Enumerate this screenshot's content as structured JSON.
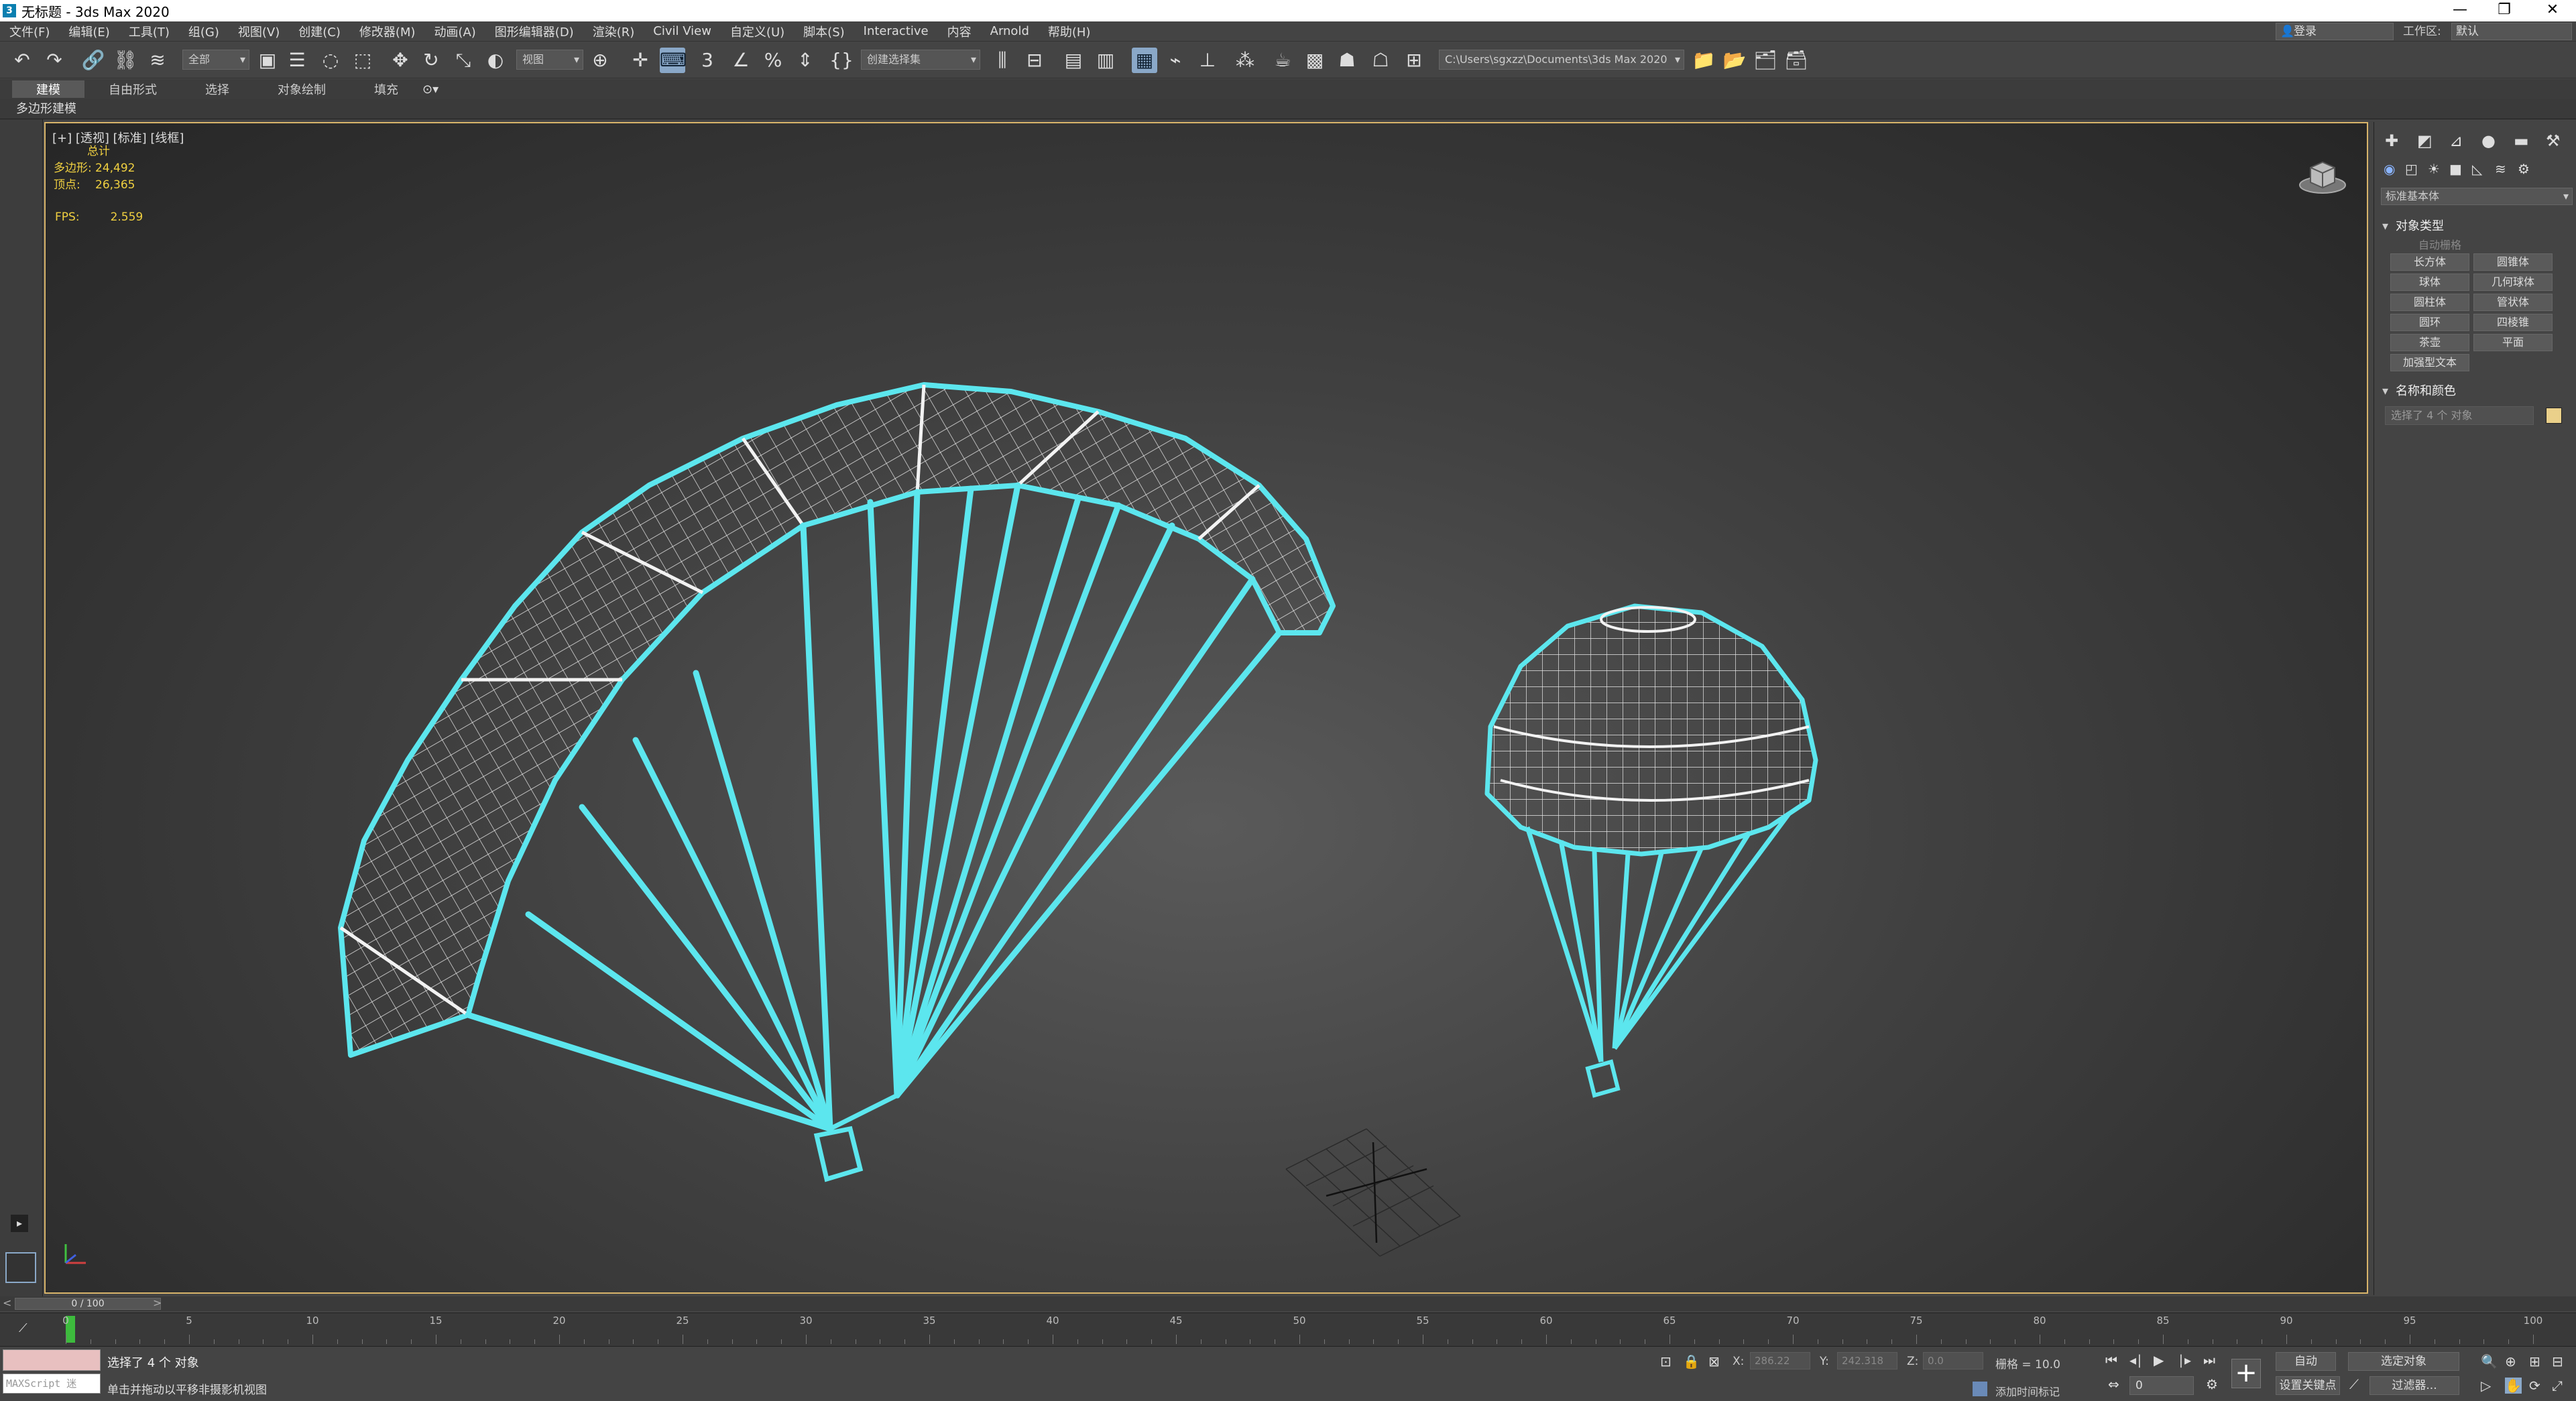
{
  "window": {
    "title": "无标题 - 3ds Max 2020",
    "app_icon": "3",
    "min": "—",
    "max": "❐",
    "close": "✕"
  },
  "menu": {
    "items": [
      "文件(F)",
      "编辑(E)",
      "工具(T)",
      "组(G)",
      "视图(V)",
      "创建(C)",
      "修改器(M)",
      "动画(A)",
      "图形编辑器(D)",
      "渲染(R)",
      "Civil View",
      "自定义(U)",
      "脚本(S)",
      "Interactive",
      "内容",
      "Arnold",
      "帮助(H)"
    ]
  },
  "account": {
    "login": "登录",
    "workspace_label": "工作区:",
    "workspace_value": "默认"
  },
  "toolbar": {
    "selection_filter": "全部",
    "ref_coord": "视图",
    "named_selection": "创建选择集",
    "project_path": "C:\\Users\\sgxzz\\Documents\\3ds Max 2020"
  },
  "ribbon": {
    "tabs": [
      "建模",
      "自由形式",
      "选择",
      "对象绘制",
      "填充"
    ],
    "active_tab": "建模",
    "sub_label": "多边形建模"
  },
  "viewport": {
    "label": "[+] [透视] [标准] [线框]",
    "stats_header": "总计",
    "poly_label": "多边形:",
    "poly_value": "24,492",
    "vert_label": "顶点:",
    "vert_value": "26,365",
    "fps_label": "FPS:",
    "fps_value": "2.559"
  },
  "command_panel": {
    "category_dropdown": "标准基本体",
    "rollout_object_type": "对象类型",
    "autogrid": "自动栅格",
    "buttons": [
      "长方体",
      "圆锥体",
      "球体",
      "几何球体",
      "圆柱体",
      "管状体",
      "圆环",
      "四棱锥",
      "茶壶",
      "平面",
      "加强型文本"
    ],
    "rollout_name_color": "名称和颜色",
    "name_field": "选择了 4 个 对象",
    "color": "#ead08a"
  },
  "timeline": {
    "slider": "0 / 100",
    "ticks": [
      "0",
      "5",
      "10",
      "15",
      "20",
      "25",
      "30",
      "35",
      "40",
      "45",
      "50",
      "55",
      "60",
      "65",
      "70",
      "75",
      "80",
      "85",
      "90",
      "95",
      "100"
    ]
  },
  "status": {
    "maxscript": "MAXScript 迷",
    "selected": "选择了 4 个 对象",
    "hint": "单击并拖动以平移非摄影机视图",
    "x_label": "X:",
    "x_value": "286.22",
    "y_label": "Y:",
    "y_value": "242.318",
    "z_label": "Z:",
    "z_value": "0.0",
    "grid": "栅格 = 10.0",
    "add_tag": "添加时间标记",
    "auto_key": "自动",
    "set_key": "设置关键点",
    "key_filter": "选定对象",
    "key_filters_btn": "过滤器...",
    "frame": "0"
  },
  "colors": {
    "wire": "#5ce6ee",
    "viewport_border": "#d8b46a",
    "stats": "#f0d040"
  }
}
